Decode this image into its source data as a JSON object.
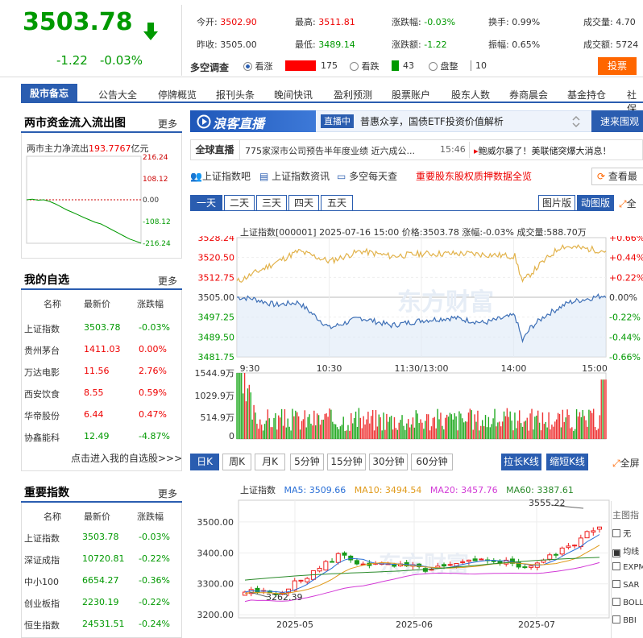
{
  "quote": {
    "price": "3503.78",
    "change": "-1.22",
    "change_pct": "-0.03%",
    "open_label": "今开:",
    "open": "3502.90",
    "high_label": "最高:",
    "high": "3511.81",
    "chgpct_label": "涨跌幅:",
    "chgpct": "-0.03%",
    "turnover_label": "换手:",
    "turnover": "0.99%",
    "vol_label": "成交量:",
    "vol": "4.70",
    "prev_label": "昨收:",
    "prev": "3505.00",
    "low_label": "最低:",
    "low": "3489.14",
    "chgamt_label": "涨跌额:",
    "chgamt": "-1.22",
    "amp_label": "振幅:",
    "amp": "0.65%",
    "amount_label": "成交额:",
    "amount": "5724"
  },
  "survey": {
    "label": "多空调查",
    "bull": "看涨",
    "bull_count": "175",
    "bear": "看跌",
    "bear_count": "43",
    "flat": "盘整",
    "flat_count": "10",
    "vote": "投票"
  },
  "nav": {
    "first": "股市备忘",
    "items": [
      "公告大全",
      "停牌概览",
      "报刊头条",
      "晚间快讯",
      "盈利预测",
      "股票账户",
      "股东人数",
      "券商晨会",
      "基金持仓",
      "社保"
    ]
  },
  "flow": {
    "title": "两市资金流入流出图",
    "more": "更多",
    "label": "两市主力净流出",
    "value": "193.7767",
    "unit": "亿元",
    "y_ticks": [
      "216.24",
      "108.12",
      "0.00",
      "-108.12",
      "-216.24"
    ],
    "series": [
      0,
      3,
      -2,
      0,
      -8,
      -20,
      -35,
      -50,
      -62,
      -75,
      -88,
      -100,
      -112,
      -120,
      -135,
      -150,
      -165,
      -180,
      -195,
      -205,
      -216
    ]
  },
  "watch": {
    "title": "我的自选",
    "more": "更多",
    "headers": [
      "名称",
      "最新价",
      "涨跌幅"
    ],
    "rows": [
      [
        "上证指数",
        "3503.78",
        "-0.03%"
      ],
      [
        "贵州茅台",
        "1411.03",
        "0.00%"
      ],
      [
        "万达电影",
        "11.56",
        "2.76%"
      ],
      [
        "西安饮食",
        "8.55",
        "0.59%"
      ],
      [
        "华帝股份",
        "6.44",
        "0.47%"
      ],
      [
        "协鑫能科",
        "12.49",
        "-4.87%"
      ]
    ],
    "link": "点击进入我的自选股>>>"
  },
  "indices": {
    "title": "重要指数",
    "more": "更多",
    "headers": [
      "名称",
      "最新价",
      "涨跌幅"
    ],
    "rows": [
      [
        "上证指数",
        "3503.78",
        "-0.03%"
      ],
      [
        "深证成指",
        "10720.81",
        "-0.22%"
      ],
      [
        "中小100",
        "6654.27",
        "-0.36%"
      ],
      [
        "创业板指",
        "2230.19",
        "-0.22%"
      ],
      [
        "恒生指数",
        "24531.51",
        "-0.24%"
      ]
    ]
  },
  "live": {
    "logo": "浪客直播",
    "badge": "直播中",
    "title": "普惠众享，国债ETF投资价值解析",
    "right": "速来围观"
  },
  "ticker": {
    "label": "全球直播",
    "text": "775家深市公司预告半年度业绩 近六成公...",
    "time": "15:46",
    "hot": "鲍威尔暴了！美联储突爆大消息！"
  },
  "links": {
    "a": "上证指数吧",
    "b": "上证指数资讯",
    "c": "多空每天查",
    "d": "重要股东股权质押数据全览",
    "e": "查看最"
  },
  "tabs": {
    "items": [
      "一天",
      "二天",
      "三天",
      "四天",
      "五天"
    ],
    "pic": "图片版",
    "dyn": "动图版",
    "full": "全"
  },
  "intraday": {
    "info": "上证指数[000001] 2025-07-16 15:00  价格:3503.78 涨幅:-0.03%  成交量:588.70万",
    "left_ticks": [
      "3528.24",
      "3520.50",
      "3512.75",
      "3505.00",
      "3497.25",
      "3489.50",
      "3481.75"
    ],
    "right_ticks": [
      "+0.66%",
      "+0.44%",
      "+0.22%",
      "0.00%",
      "-0.22%",
      "-0.44%",
      "-0.66%"
    ],
    "x_ticks": [
      "9:30",
      "10:30",
      "11:30/13:00",
      "14:00",
      "15:00"
    ],
    "vol_ticks": [
      "1544.9万",
      "1029.9万",
      "514.9万",
      "0"
    ],
    "watermark": "东方财富"
  },
  "kline": {
    "tabs": [
      "日K",
      "周K",
      "月K",
      "5分钟",
      "15分钟",
      "30分钟",
      "60分钟"
    ],
    "btn1": "拉长K线",
    "btn2": "缩短K线",
    "full": "全屏",
    "name": "上证指数",
    "ma5": "MA5: 3509.66",
    "ma10": "MA10: 3494.54",
    "ma20": "MA20: 3457.76",
    "ma60": "MA60: 3387.61",
    "y_ticks": [
      "3500.00",
      "3400.00",
      "3300.00",
      "3200.00"
    ],
    "x_ticks": [
      "2025-05",
      "2025-06",
      "2025-07"
    ],
    "high_mark": "3555.22",
    "low_mark": "3262.39",
    "side_title": "主图指",
    "side": [
      "无",
      "均线",
      "EXPM",
      "SAR",
      "BOLL",
      "BBI"
    ],
    "watermark": "东方财富"
  },
  "colors": {
    "blue": "#2a5db0",
    "red": "#e00",
    "green": "#090"
  }
}
